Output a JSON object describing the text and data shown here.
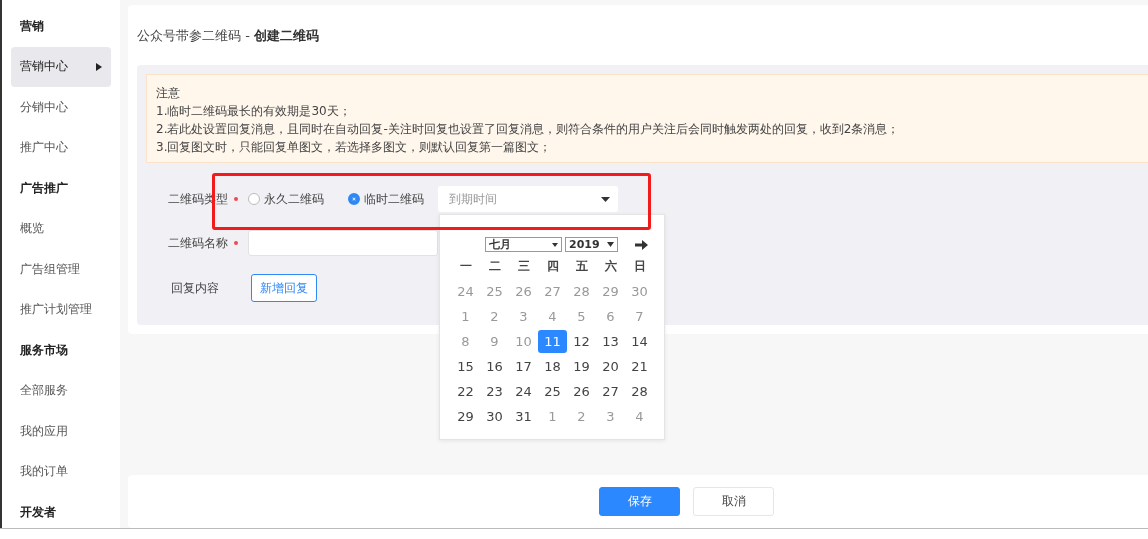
{
  "sidebar": {
    "items": [
      {
        "kind": "header",
        "label": "营销"
      },
      {
        "kind": "item",
        "label": "营销中心",
        "selected": true
      },
      {
        "kind": "item",
        "label": "分销中心",
        "selected": false
      },
      {
        "kind": "item",
        "label": "推广中心",
        "selected": false
      },
      {
        "kind": "header",
        "label": "广告推广"
      },
      {
        "kind": "item",
        "label": "概览",
        "selected": false
      },
      {
        "kind": "item",
        "label": "广告组管理",
        "selected": false
      },
      {
        "kind": "item",
        "label": "推广计划管理",
        "selected": false
      },
      {
        "kind": "header",
        "label": "服务市场"
      },
      {
        "kind": "item",
        "label": "全部服务",
        "selected": false
      },
      {
        "kind": "item",
        "label": "我的应用",
        "selected": false
      },
      {
        "kind": "item",
        "label": "我的订单",
        "selected": false
      },
      {
        "kind": "header",
        "label": "开发者"
      }
    ]
  },
  "page": {
    "breadcrumb": "公众号带参二维码",
    "separator": "-",
    "title": "创建二维码"
  },
  "notice": {
    "heading": "注意",
    "lines": [
      "1.临时二维码最长的有效期是30天；",
      "2.若此处设置回复消息，且同时在自动回复-关注时回复也设置了回复消息，则符合条件的用户关注后会同时触发两处的回复，收到2条消息；",
      "3.回复图文时，只能回复单图文，若选择多图文，则默认回复第一篇图文；"
    ]
  },
  "form": {
    "type_label": "二维码类型",
    "type_required": true,
    "type_options": [
      {
        "label": "永久二维码",
        "selected": false
      },
      {
        "label": "临时二维码",
        "selected": true
      }
    ],
    "expiry": {
      "placeholder": "到期时间"
    },
    "name_label": "二维码名称",
    "name_required": true,
    "reply_label": "回复内容",
    "add_reply_button": "新增回复"
  },
  "calendar": {
    "month": "七月",
    "year": "2019",
    "weekdays": [
      "一",
      "二",
      "三",
      "四",
      "五",
      "六",
      "日"
    ],
    "weeks": [
      [
        {
          "text": "24",
          "disabled": true,
          "selected": false
        },
        {
          "text": "25",
          "disabled": true,
          "selected": false
        },
        {
          "text": "26",
          "disabled": true,
          "selected": false
        },
        {
          "text": "27",
          "disabled": true,
          "selected": false
        },
        {
          "text": "28",
          "disabled": true,
          "selected": false
        },
        {
          "text": "29",
          "disabled": true,
          "selected": false
        },
        {
          "text": "30",
          "disabled": true,
          "selected": false
        }
      ],
      [
        {
          "text": "1",
          "disabled": true,
          "selected": false
        },
        {
          "text": "2",
          "disabled": true,
          "selected": false
        },
        {
          "text": "3",
          "disabled": true,
          "selected": false
        },
        {
          "text": "4",
          "disabled": true,
          "selected": false
        },
        {
          "text": "5",
          "disabled": true,
          "selected": false
        },
        {
          "text": "6",
          "disabled": true,
          "selected": false
        },
        {
          "text": "7",
          "disabled": true,
          "selected": false
        }
      ],
      [
        {
          "text": "8",
          "disabled": true,
          "selected": false
        },
        {
          "text": "9",
          "disabled": true,
          "selected": false
        },
        {
          "text": "10",
          "disabled": true,
          "selected": false
        },
        {
          "text": "11",
          "disabled": false,
          "selected": true
        },
        {
          "text": "12",
          "disabled": false,
          "selected": false
        },
        {
          "text": "13",
          "disabled": false,
          "selected": false
        },
        {
          "text": "14",
          "disabled": false,
          "selected": false
        }
      ],
      [
        {
          "text": "15",
          "disabled": false,
          "selected": false
        },
        {
          "text": "16",
          "disabled": false,
          "selected": false
        },
        {
          "text": "17",
          "disabled": false,
          "selected": false
        },
        {
          "text": "18",
          "disabled": false,
          "selected": false
        },
        {
          "text": "19",
          "disabled": false,
          "selected": false
        },
        {
          "text": "20",
          "disabled": false,
          "selected": false
        },
        {
          "text": "21",
          "disabled": false,
          "selected": false
        }
      ],
      [
        {
          "text": "22",
          "disabled": false,
          "selected": false
        },
        {
          "text": "23",
          "disabled": false,
          "selected": false
        },
        {
          "text": "24",
          "disabled": false,
          "selected": false
        },
        {
          "text": "25",
          "disabled": false,
          "selected": false
        },
        {
          "text": "26",
          "disabled": false,
          "selected": false
        },
        {
          "text": "27",
          "disabled": false,
          "selected": false
        },
        {
          "text": "28",
          "disabled": false,
          "selected": false
        }
      ],
      [
        {
          "text": "29",
          "disabled": false,
          "selected": false
        },
        {
          "text": "30",
          "disabled": false,
          "selected": false
        },
        {
          "text": "31",
          "disabled": false,
          "selected": false
        },
        {
          "text": "1",
          "disabled": true,
          "selected": false
        },
        {
          "text": "2",
          "disabled": true,
          "selected": false
        },
        {
          "text": "3",
          "disabled": true,
          "selected": false
        },
        {
          "text": "4",
          "disabled": true,
          "selected": false
        }
      ]
    ]
  },
  "footer": {
    "buttons": [
      {
        "kind": "primary",
        "label": "保存"
      },
      {
        "kind": "default",
        "label": "取消"
      }
    ]
  }
}
